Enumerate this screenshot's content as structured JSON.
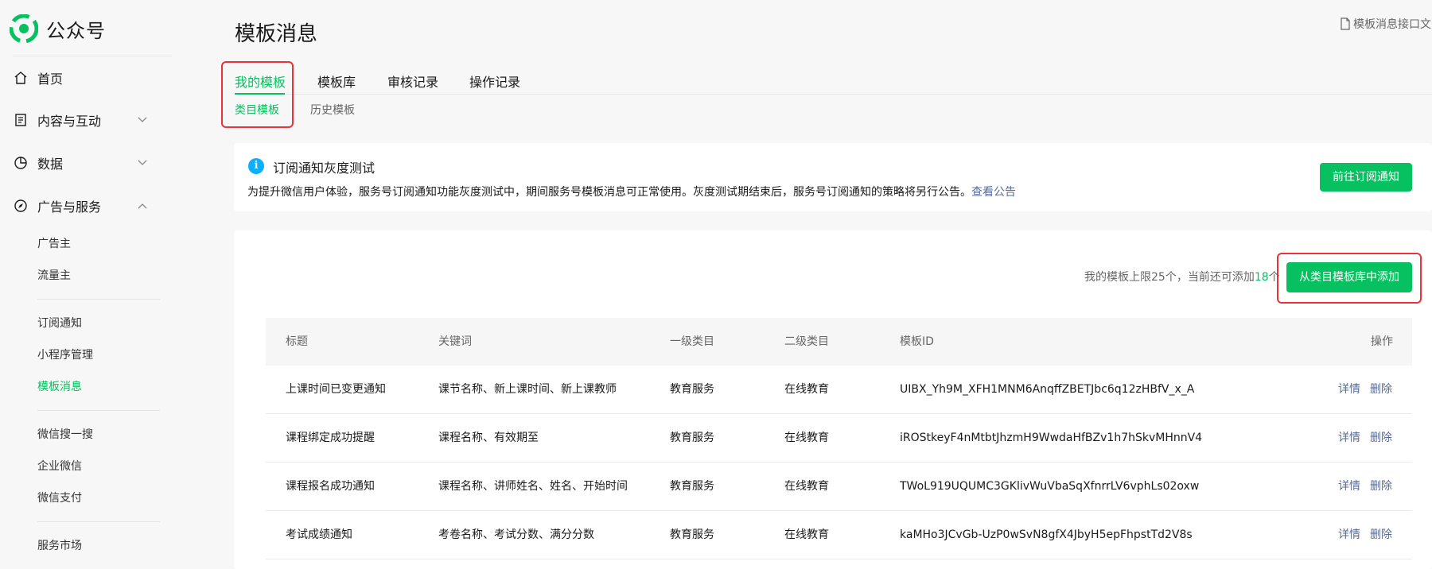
{
  "app": {
    "name": "公众号"
  },
  "sidebar": {
    "items": [
      {
        "label": "首页",
        "icon": "home-icon"
      },
      {
        "label": "内容与互动",
        "icon": "document-icon",
        "expandable": true,
        "expanded": false
      },
      {
        "label": "数据",
        "icon": "pie-chart-icon",
        "expandable": true,
        "expanded": false
      },
      {
        "label": "广告与服务",
        "icon": "compass-icon",
        "expandable": true,
        "expanded": true
      }
    ],
    "subitems": [
      "广告主",
      "流量主",
      "订阅通知",
      "小程序管理",
      "模板消息",
      "微信搜一搜",
      "企业微信",
      "微信支付",
      "服务市场"
    ],
    "active_subitem": "模板消息"
  },
  "header": {
    "title": "模板消息",
    "doc_link": "模板消息接口文"
  },
  "tabs": [
    "我的模板",
    "模板库",
    "审核记录",
    "操作记录"
  ],
  "active_tab": "我的模板",
  "subtabs": [
    "类目模板",
    "历史模板"
  ],
  "active_subtab": "类目模板",
  "notice": {
    "title": "订阅通知灰度测试",
    "text": "为提升微信用户体验，服务号订阅通知功能灰度测试中，期间服务号模板消息可正常使用。灰度测试期结束后，服务号订阅通知的策略将另行公告。",
    "link": "查看公告",
    "button": "前往订阅通知"
  },
  "limits": {
    "prefix": "我的模板上限25个，当前还可添加",
    "remaining": "18",
    "suffix": "个"
  },
  "add_button": "从类目模板库中添加",
  "table": {
    "columns": [
      "标题",
      "关键词",
      "一级类目",
      "二级类目",
      "模板ID",
      "操作"
    ],
    "rows": [
      {
        "title": "上课时间已变更通知",
        "keywords": "课节名称、新上课时间、新上课教师",
        "cat1": "教育服务",
        "cat2": "在线教育",
        "id": "UIBX_Yh9M_XFH1MNM6AnqffZBETJbc6q12zHBfV_x_A",
        "detail": "详情",
        "delete": "删除"
      },
      {
        "title": "课程绑定成功提醒",
        "keywords": "课程名称、有效期至",
        "cat1": "教育服务",
        "cat2": "在线教育",
        "id": "iROStkeyF4nMtbtJhzmH9WwdaHfBZv1h7hSkvMHnnV4",
        "detail": "详情",
        "delete": "删除"
      },
      {
        "title": "课程报名成功通知",
        "keywords": "课程名称、讲师姓名、姓名、开始时间",
        "cat1": "教育服务",
        "cat2": "在线教育",
        "id": "TWoL919UQUMC3GKlivWuVbaSqXfnrrLV6vphLs02oxw",
        "detail": "详情",
        "delete": "删除"
      },
      {
        "title": "考试成绩通知",
        "keywords": "考卷名称、考试分数、满分分数",
        "cat1": "教育服务",
        "cat2": "在线教育",
        "id": "kaMHo3JCvGb-UzP0wSvN8gfX4JbyH5epFhpstTd2V8s",
        "detail": "详情",
        "delete": "删除"
      }
    ]
  },
  "colors": {
    "accent": "#07c160",
    "link": "#576b95",
    "highlight_box": "#e8333a",
    "info": "#10aeff"
  }
}
